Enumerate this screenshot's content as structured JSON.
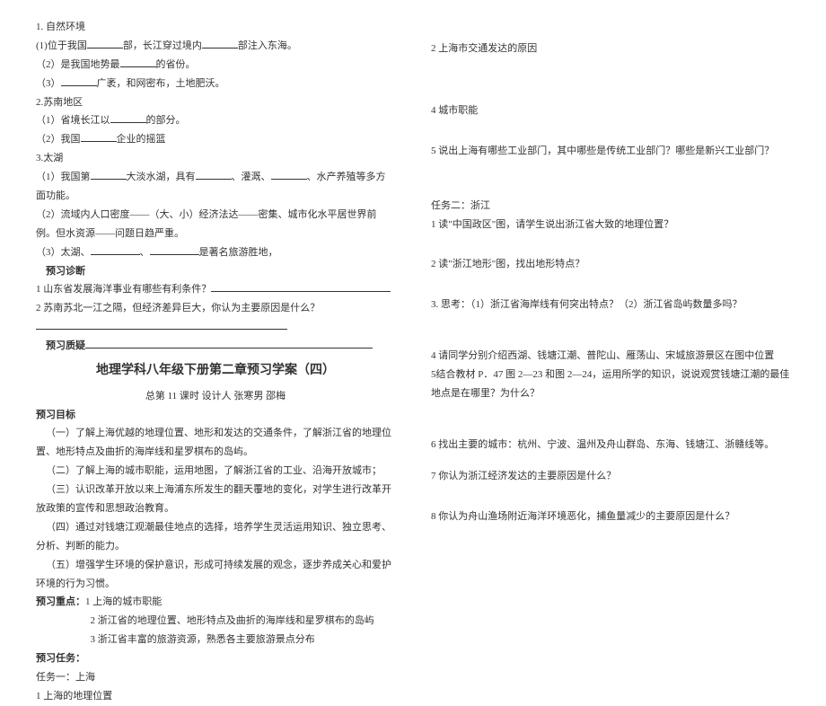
{
  "left": {
    "s1_title": "1. 自然环境",
    "s1_1a": "(1)位于我国",
    "s1_1b": "部，长江穿过境内",
    "s1_1c": "部注入东海。",
    "s1_2a": "（2）是我国地势最",
    "s1_2b": "的省份。",
    "s1_3a": "（3）",
    "s1_3b": "广袤，和网密布，土地肥沃。",
    "s2_title": "2.苏南地区",
    "s2_1a": "（1）省境长江以",
    "s2_1b": "的部分。",
    "s2_2a": "（2）我国",
    "s2_2b": "企业的摇篮",
    "s3_title": "3.太湖",
    "s3_1a": "（1）我国第",
    "s3_1b": "大淡水湖，具有",
    "s3_1c": "、灌溉、",
    "s3_1d": "、水产养殖等多方面功能。",
    "s3_2": "（2）流域内人口密度——（大、小）经济法达——密集、城市化水平居世界前例。但水资源——问题日趋严重。",
    "s3_3a": "（3）太湖、",
    "s3_3b": "、",
    "s3_3c": "是著名旅游胜地，",
    "diag_title": "预习诊断",
    "diag_1": "1 山东省发展海洋事业有哪些有利条件？",
    "diag_2": "2 苏南苏北一江之隔，但经济差异巨大，你认为主要原因是什么？",
    "qz_title": "预习质疑",
    "main_title": "地理学科八年级下册第二章预习学案（四）",
    "sub_title": "总第 11 课时    设计人  张寒男  邵梅",
    "goal_title": "预习目标",
    "goal_1": "（一）了解上海优越的地理位置、地形和发达的交通条件，了解浙江省的地理位置、地形特点及曲折的海岸线和星罗棋布的岛屿。",
    "goal_2": "（二）了解上海的城市职能，运用地图，了解浙江省的工业、沿海开放城市；",
    "goal_3": "（三）认识改革开放以来上海浦东所发生的翻天覆地的变化，对学生进行改革开放政策的宣传和思想政治教育。",
    "goal_4": "（四）通过对钱塘江观潮最佳地点的选择，培养学生灵活运用知识、独立思考、分析、判断的能力。",
    "goal_5": "（五）增强学生环境的保护意识，形成可持续发展的观念，逐步养成关心和爱护环境的行为习惯。",
    "focus_title": "预习重点：",
    "focus_1": "1 上海的城市职能",
    "focus_2": "2 浙江省的地理位置、地形特点及曲折的海岸线和星罗棋布的岛屿",
    "focus_3": "3 浙江省丰富的旅游资源，熟悉各主要旅游景点分布",
    "task_title": "预习任务：",
    "task1_title": "任务一：上海",
    "task1_1": "1 上海的地理位置"
  },
  "right": {
    "r2": "2 上海市交通发达的原因",
    "r4": "4 城市职能",
    "r5": "5 说出上海有哪些工业部门，其中哪些是传统工业部门？哪些是新兴工业部门？",
    "t2_title": "任务二：浙江",
    "t2_1": "1 读\"中国政区\"图，请学生说出浙江省大致的地理位置？",
    "t2_2": "2 读\"浙江地形\"图，找出地形特点？",
    "t2_3": "3. 思考：（1）浙江省海岸线有何突出特点？（2）浙江省岛屿数量多吗？",
    "t2_4": "4 请同学分别介绍西湖、钱塘江潮、普陀山、雁荡山、宋城旅游景区在图中位置",
    "t2_5": "5结合教材 P．47 图 2—23 和图 2—24，运用所学的知识，说说观赏钱塘江潮的最佳地点是在哪里？为什么？",
    "t2_6": "6 找出主要的城市：杭州、宁波、温州及舟山群岛、东海、钱塘江、浙赣线等。",
    "t2_7": "7 你认为浙江经济发达的主要原因是什么？",
    "t2_8": "8 你认为舟山渔场附近海洋环境恶化，捕鱼量减少的主要原因是什么？"
  }
}
